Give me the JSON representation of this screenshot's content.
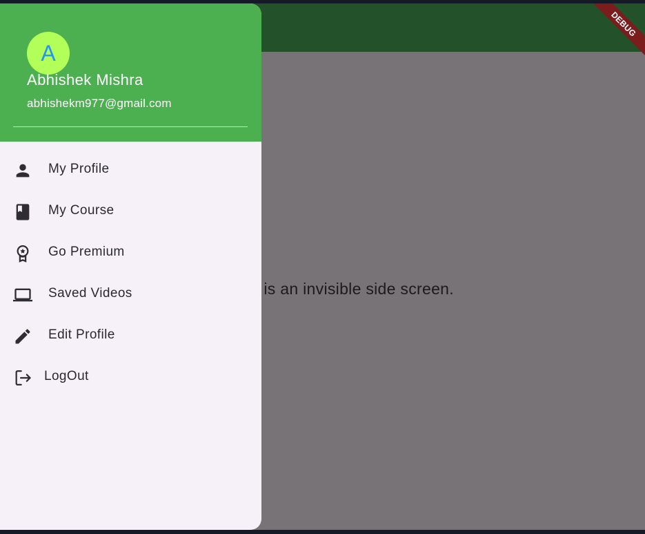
{
  "app": {
    "debug_banner": "DEBUG",
    "body_text": "This is an invisible side screen."
  },
  "drawer": {
    "header": {
      "avatar_initial": "A",
      "account_name": "Abhishek Mishra",
      "account_email": "abhishekm977@gmail.com",
      "colors": {
        "header_bg": "#4caf50",
        "avatar_bg": "#b2ff59",
        "avatar_text": "#2196f3"
      }
    },
    "items": [
      {
        "label": "My Profile",
        "icon": "person-icon"
      },
      {
        "label": "My Course",
        "icon": "book-icon"
      },
      {
        "label": "Go Premium",
        "icon": "premium-badge-icon"
      },
      {
        "label": "Saved Videos",
        "icon": "laptop-icon"
      },
      {
        "label": "Edit Profile",
        "icon": "edit-icon"
      },
      {
        "label": "LogOut",
        "icon": "logout-icon"
      }
    ]
  }
}
